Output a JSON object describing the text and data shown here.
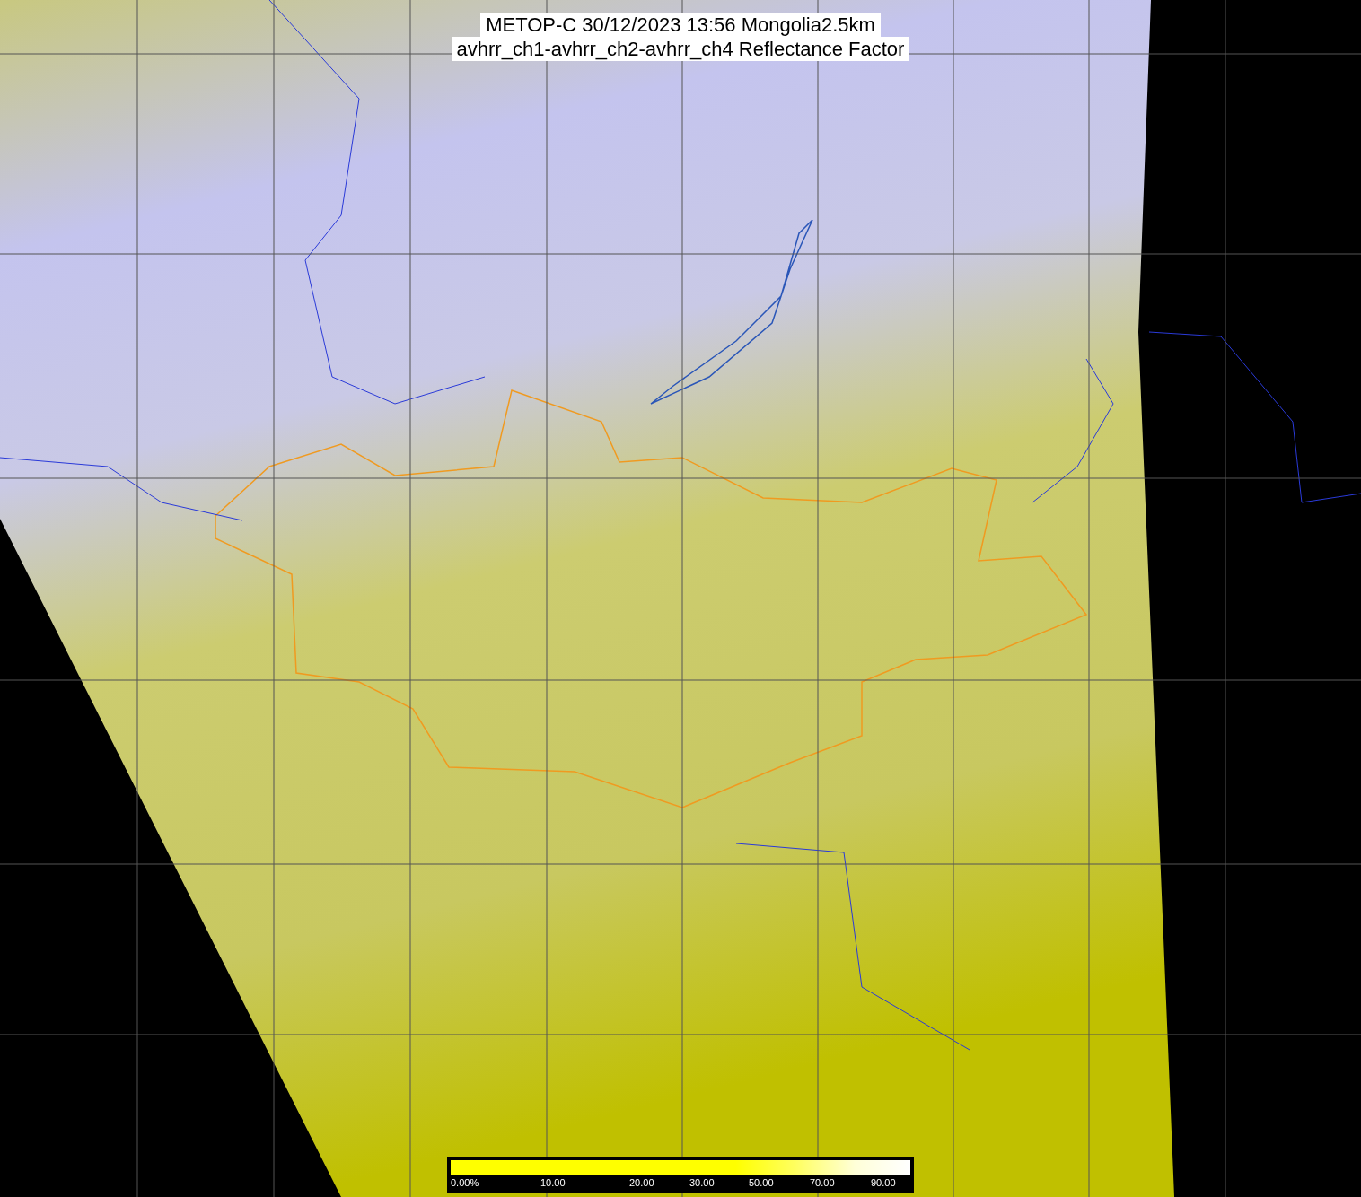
{
  "title": {
    "lines": [
      "METOP-C 30/12/2023 13:56 Mongolia2.5km",
      "avhrr_ch1-avhrr_ch2-avhrr_ch4 Reflectance Factor"
    ]
  },
  "colorbar": {
    "labels": [
      "0.00%",
      "10.00",
      "20.00",
      "30.00",
      "50.00",
      "70.00",
      "90.00"
    ]
  }
}
